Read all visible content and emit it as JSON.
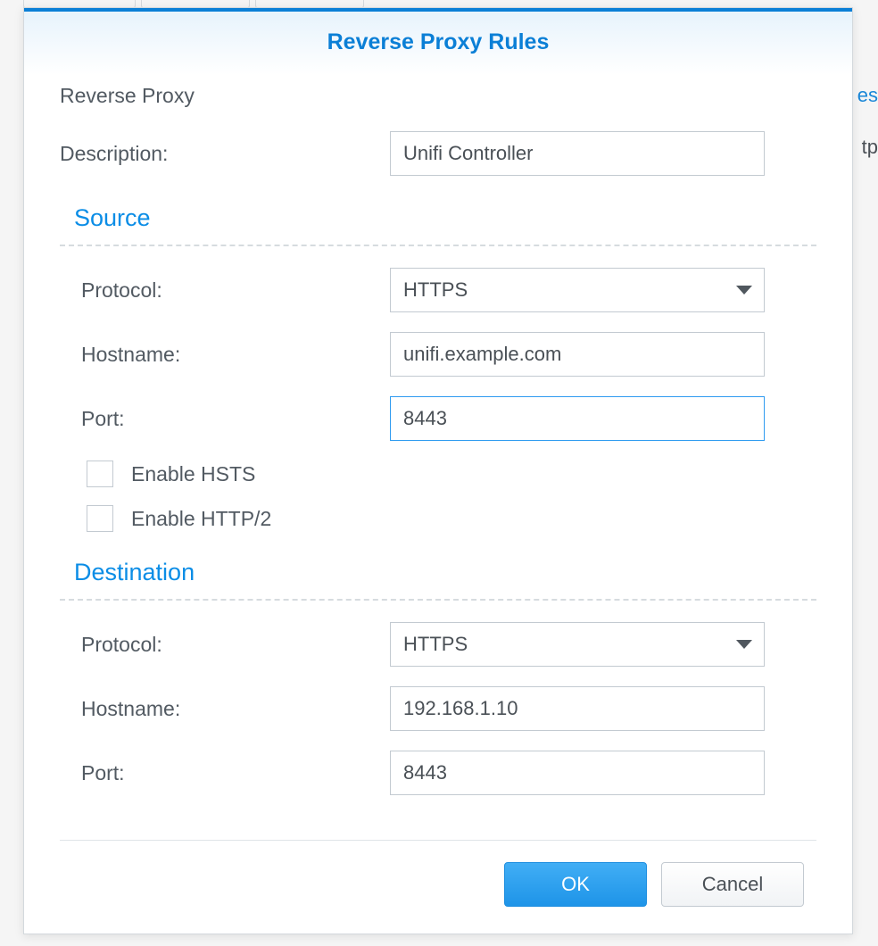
{
  "dialog": {
    "title": "Reverse Proxy Rules",
    "subtitle": "Reverse Proxy"
  },
  "description": {
    "label": "Description:",
    "value": "Unifi Controller"
  },
  "source": {
    "heading": "Source",
    "protocol_label": "Protocol:",
    "protocol_value": "HTTPS",
    "hostname_label": "Hostname:",
    "hostname_value": "unifi.example.com",
    "port_label": "Port:",
    "port_value": "8443",
    "hsts_label": "Enable HSTS",
    "http2_label": "Enable HTTP/2"
  },
  "destination": {
    "heading": "Destination",
    "protocol_label": "Protocol:",
    "protocol_value": "HTTPS",
    "hostname_label": "Hostname:",
    "hostname_value": "192.168.1.10",
    "port_label": "Port:",
    "port_value": "8443"
  },
  "buttons": {
    "ok": "OK",
    "cancel": "Cancel"
  },
  "background": {
    "frag1": "es",
    "frag2": "tp"
  }
}
